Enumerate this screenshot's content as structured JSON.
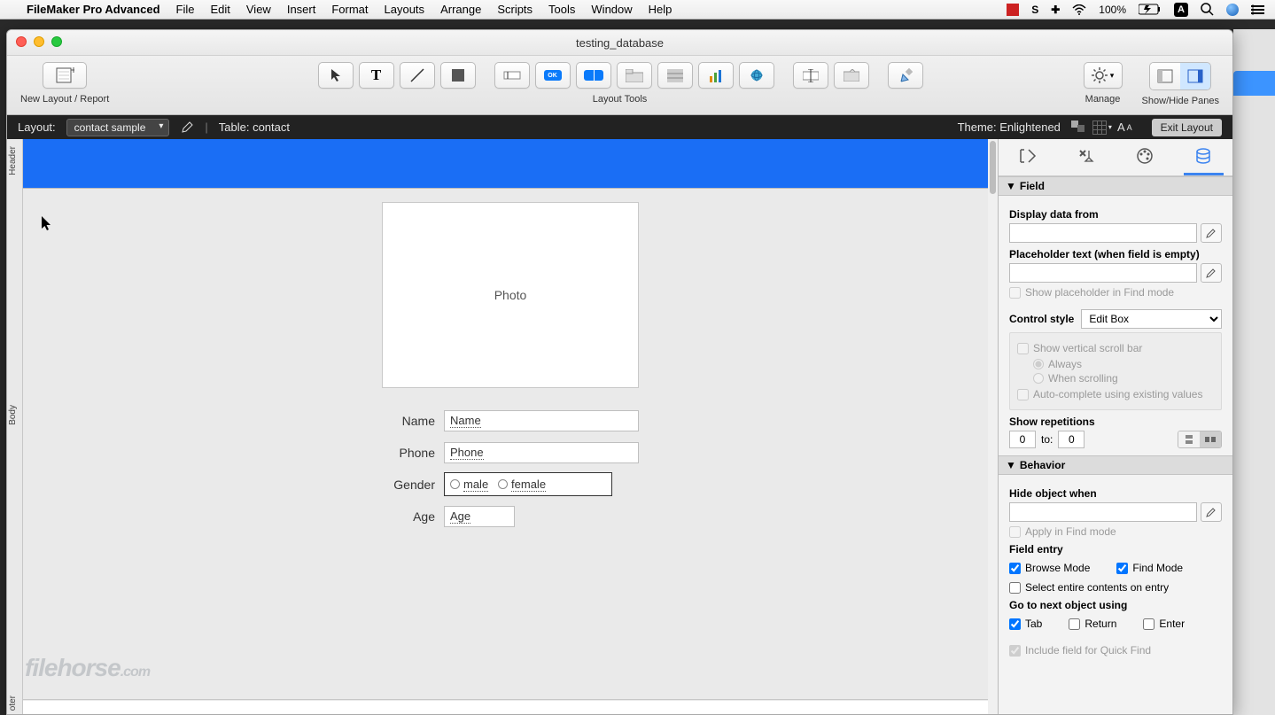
{
  "menubar": {
    "app": "FileMaker Pro Advanced",
    "items": [
      "File",
      "Edit",
      "View",
      "Insert",
      "Format",
      "Layouts",
      "Arrange",
      "Scripts",
      "Tools",
      "Window",
      "Help"
    ],
    "battery": "100%",
    "input_icon": "A"
  },
  "window": {
    "title": "testing_database"
  },
  "toolbar": {
    "new_layout_label": "New Layout / Report",
    "layout_tools_label": "Layout Tools",
    "manage_label": "Manage",
    "panes_label": "Show/Hide Panes"
  },
  "layoutbar": {
    "layout_label": "Layout:",
    "layout_name": "contact sample",
    "table_label": "Table: contact",
    "theme_label": "Theme: Enlightened",
    "exit_label": "Exit Layout"
  },
  "parts": {
    "header": "Header",
    "body": "Body",
    "footer": "oter"
  },
  "canvas": {
    "photo_label": "Photo",
    "fields": {
      "name": {
        "label": "Name",
        "value": "Name"
      },
      "phone": {
        "label": "Phone",
        "value": "Phone"
      },
      "gender": {
        "label": "Gender",
        "opt_male": "male",
        "opt_female": "female"
      },
      "age": {
        "label": "Age",
        "value": "Age"
      }
    }
  },
  "inspector": {
    "section_field": "Field",
    "display_from": "Display data from",
    "placeholder_lbl": "Placeholder text (when field is empty)",
    "show_placeholder_find": "Show placeholder in Find mode",
    "control_style_lbl": "Control style",
    "control_style_val": "Edit Box",
    "show_vscroll": "Show vertical scroll bar",
    "vs_always": "Always",
    "vs_scrolling": "When scrolling",
    "autocomplete": "Auto-complete using existing values",
    "show_rep_lbl": "Show repetitions",
    "rep_from": "0",
    "rep_to_lbl": "to:",
    "rep_to": "0",
    "section_behavior": "Behavior",
    "hide_when": "Hide object when",
    "apply_find": "Apply in Find mode",
    "field_entry_lbl": "Field entry",
    "browse_mode": "Browse Mode",
    "find_mode": "Find Mode",
    "select_entire": "Select entire contents on entry",
    "go_next_lbl": "Go to next object using",
    "go_tab": "Tab",
    "go_return": "Return",
    "go_enter": "Enter",
    "include_quick": "Include field for Quick Find"
  },
  "watermark": {
    "a": "filehorse",
    "b": ".com"
  }
}
